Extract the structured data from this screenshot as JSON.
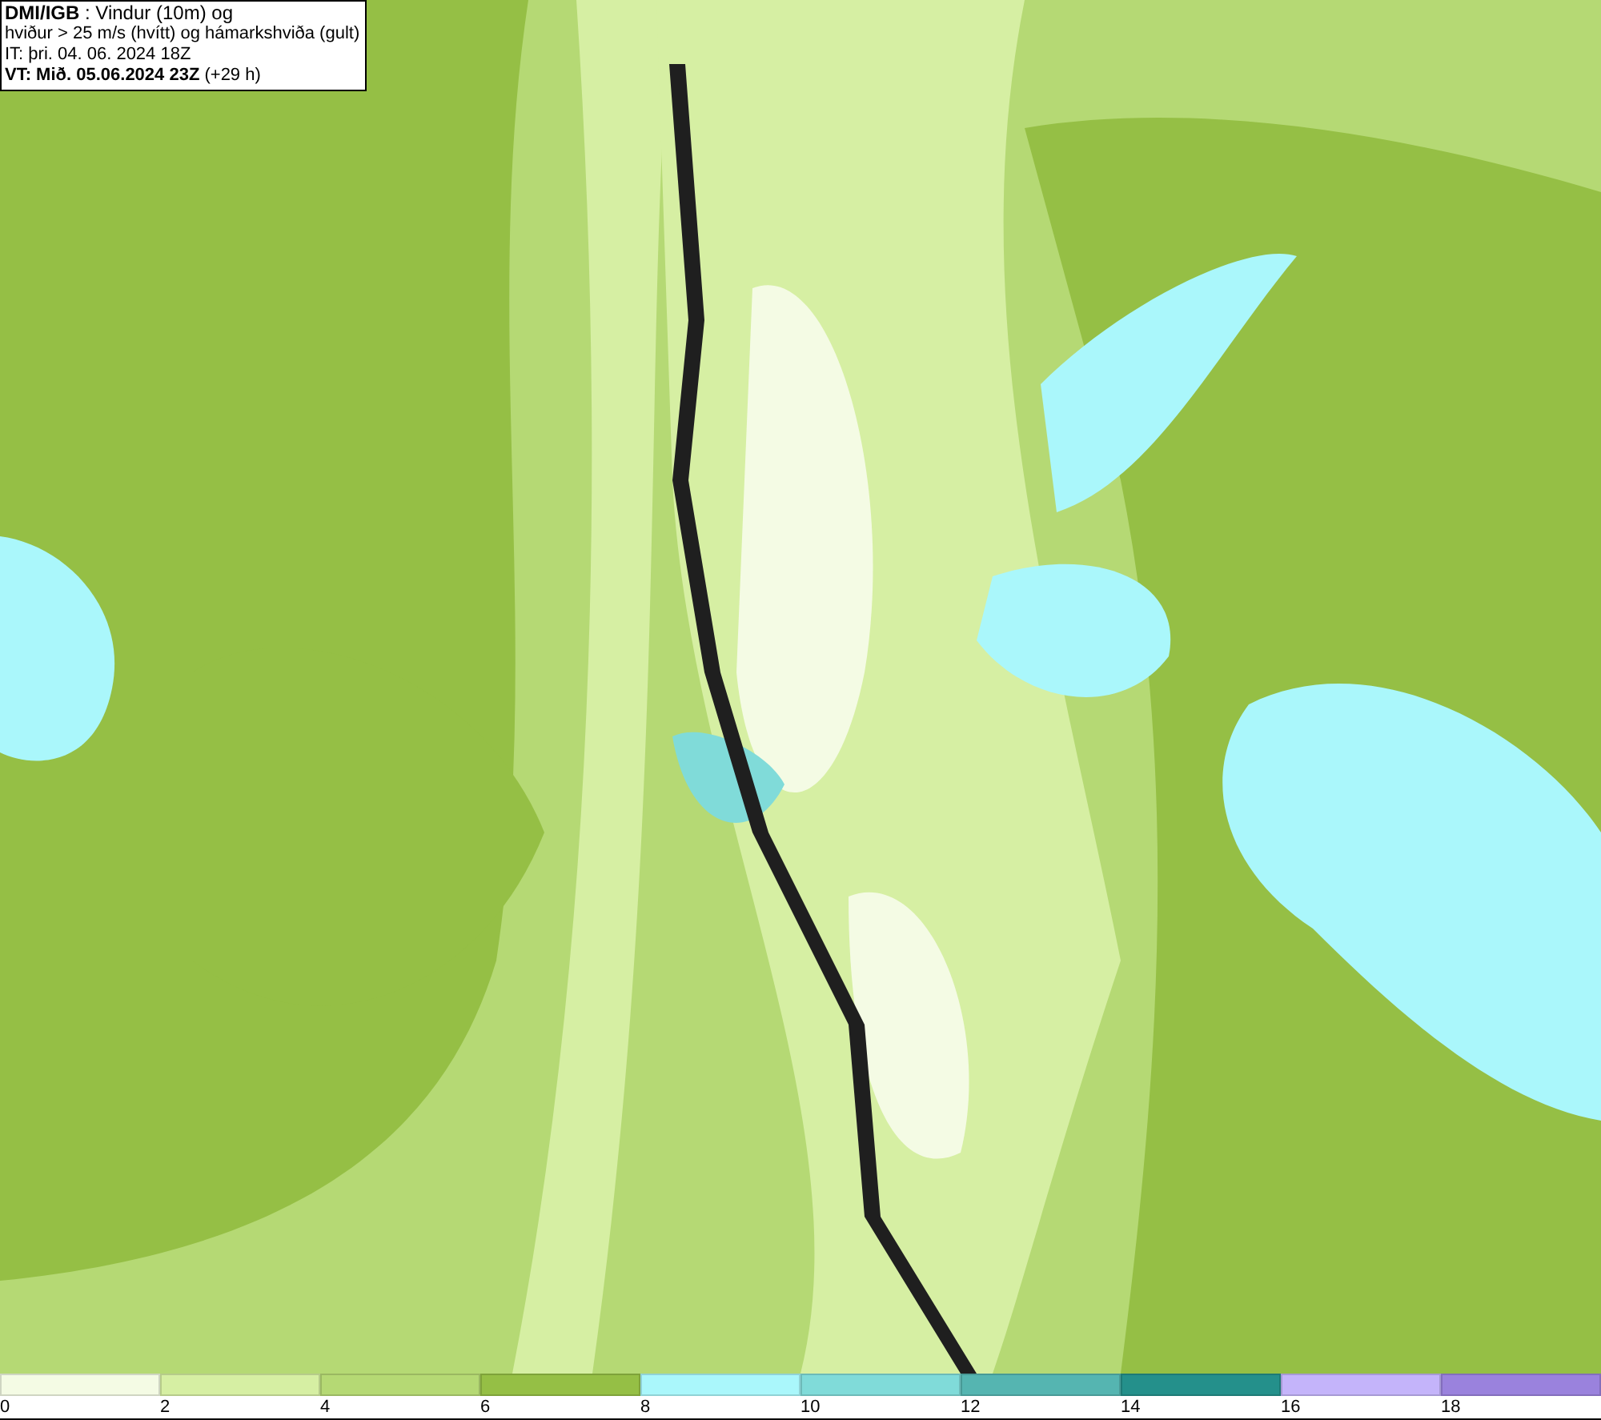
{
  "header": {
    "lines": [
      "**DMI/IGB** : Vindur (10m) og",
      "hviður > 25 m/s (hvítt) og hámarkshviða (gult)",
      "IT: þri. 04. 06. 2024 18Z",
      "**VT: Mið. 05.06.2024 23Z** (+29 h)"
    ]
  },
  "legend": {
    "bins": [
      {
        "label": "0",
        "color": "#f4fbe4"
      },
      {
        "label": "2",
        "color": "#d6efa3"
      },
      {
        "label": "4",
        "color": "#b5d974"
      },
      {
        "label": "6",
        "color": "#95bf45"
      },
      {
        "label": "8",
        "color": "#aaf7fb"
      },
      {
        "label": "10",
        "color": "#80dbd9"
      },
      {
        "label": "12",
        "color": "#55b5b1"
      },
      {
        "label": "14",
        "color": "#24908b"
      },
      {
        "label": "16",
        "color": "#c4b4fa"
      },
      {
        "label": "18",
        "color": "#9a82dd"
      }
    ]
  }
}
